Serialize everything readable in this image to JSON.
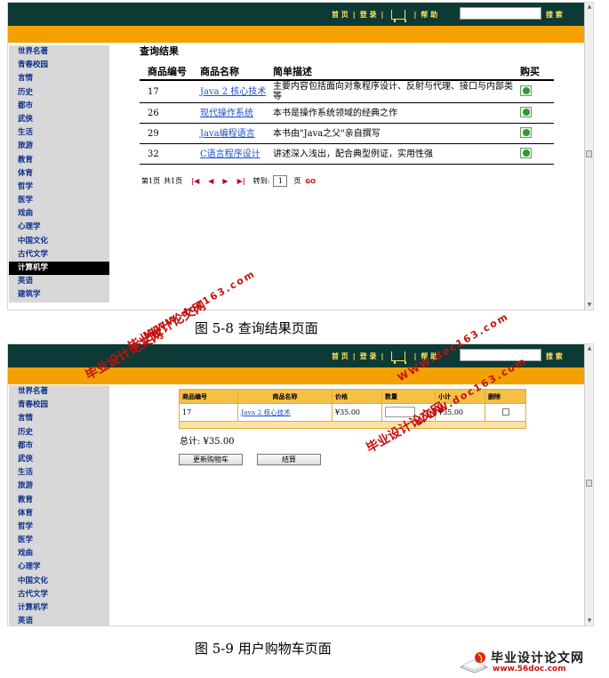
{
  "header": {
    "nav": [
      "首 页",
      "登 录",
      "帮 助"
    ],
    "search_label": "搜 索"
  },
  "categories": [
    "世界名著",
    "青春校园",
    "言情",
    "历史",
    "都市",
    "武侠",
    "生活",
    "旅游",
    "教育",
    "体育",
    "哲学",
    "医学",
    "戏曲",
    "心理学",
    "中国文化",
    "古代文学",
    "计算机学",
    "英语",
    "建筑学"
  ],
  "figure1": {
    "active_category": "计算机学",
    "title": "查询结果",
    "headers": [
      "商品编号",
      "商品名称",
      "简单描述",
      "购买"
    ],
    "rows": [
      {
        "id": "17",
        "name": "Java 2 核心技术",
        "desc": "主要内容包括面向对象程序设计、反射与代理、接口与内部类等"
      },
      {
        "id": "26",
        "name": "现代操作系统",
        "desc": "本书是操作系统领域的经典之作"
      },
      {
        "id": "29",
        "name": "Java编程语言",
        "desc": "本书由\"Java之父\"亲自撰写"
      },
      {
        "id": "32",
        "name": "C语言程序设计",
        "desc": "讲述深入浅出，配合典型例证，实用性强"
      }
    ],
    "pager": {
      "current": "第1页",
      "total": "共1页",
      "goto_label": "转到:",
      "page_value": "1",
      "page_unit": "页",
      "go_label": "GO"
    },
    "caption": "图 5-8    查询结果页面"
  },
  "figure2": {
    "headers": [
      "商品编号",
      "商品名称",
      "价格",
      "数量",
      "小计",
      "删除"
    ],
    "row": {
      "id": "17",
      "name": "Java 2 核心技术",
      "price": "¥35.00",
      "subtotal": "¥35.00"
    },
    "total": "总计: ¥35.00",
    "update_button": "更新购物车",
    "checkout_button": "结算",
    "caption": "图 5-9    用户购物车页面"
  },
  "watermark": {
    "site_cn": "毕业设计论文网",
    "site_url": "WWW.doc163.com"
  },
  "logo": {
    "text": "毕业设计论文网",
    "url": "www.56doc.com"
  },
  "colors": {
    "header_bg": "#0d3a35",
    "orange_bar": "#f4a000",
    "nav_text": "#ffe25a",
    "sidebar_bg": "#d8d8d8",
    "sidebar_link": "#0c2e8a",
    "watermark": "#c51111"
  }
}
